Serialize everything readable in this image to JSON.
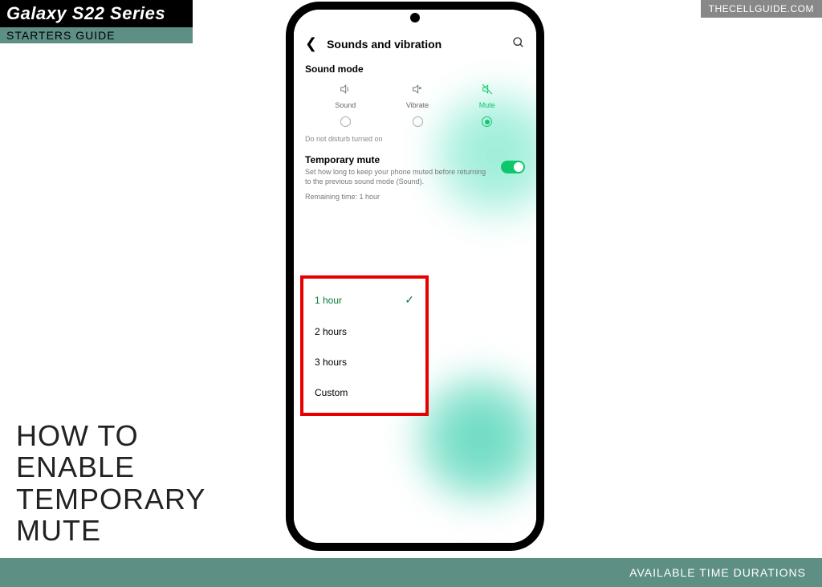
{
  "badges": {
    "series": "Galaxy S22 Series",
    "guide": "STARTERS GUIDE",
    "site": "THECELLGUIDE.COM"
  },
  "title_lines": [
    "HOW TO",
    "ENABLE",
    "TEMPORARY",
    "MUTE"
  ],
  "bottom_bar": "AVAILABLE TIME DURATIONS",
  "phone": {
    "header": {
      "title": "Sounds and vibration"
    },
    "sound_mode": {
      "label": "Sound mode",
      "modes": [
        {
          "name": "Sound",
          "active": false
        },
        {
          "name": "Vibrate",
          "active": false
        },
        {
          "name": "Mute",
          "active": true
        }
      ],
      "dnd_note": "Do not disturb turned on"
    },
    "temp_mute": {
      "title": "Temporary mute",
      "desc": "Set how long to keep your phone muted before returning to the previous sound mode (Sound).",
      "remaining": "Remaining time: 1 hour",
      "toggle_on": true
    },
    "dropdown": {
      "selected_index": 0,
      "options": [
        "1 hour",
        "2 hours",
        "3 hours",
        "Custom"
      ]
    }
  }
}
